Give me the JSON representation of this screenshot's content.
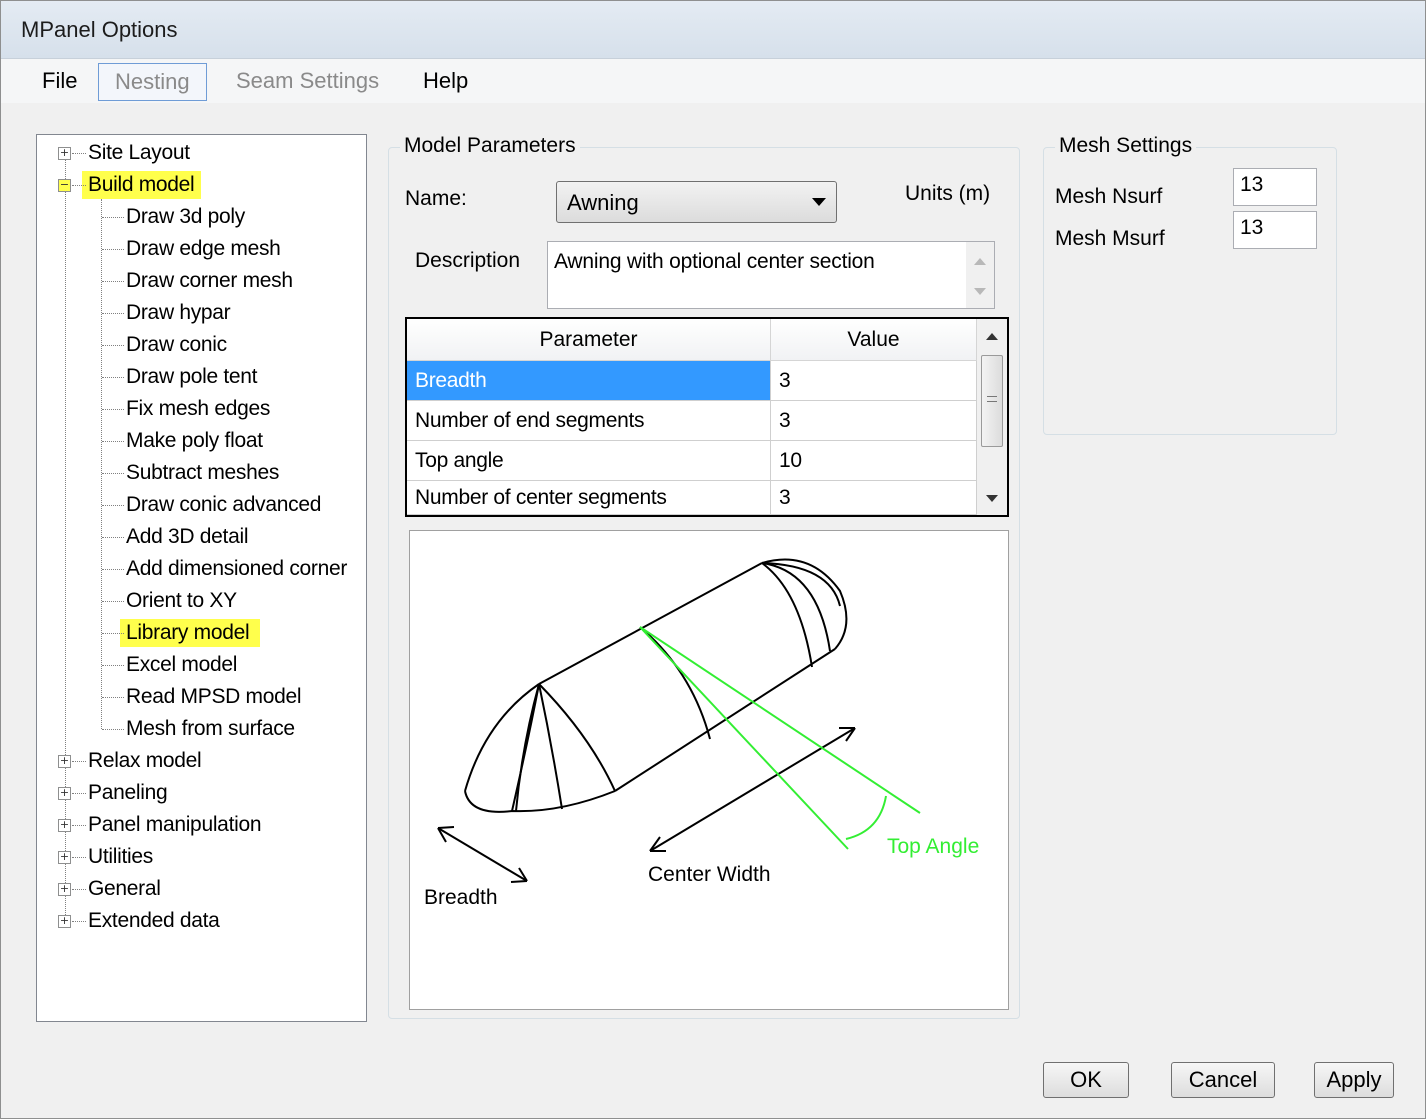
{
  "window": {
    "title": "MPanel Options"
  },
  "menu": [
    {
      "label": "File",
      "enabled": true
    },
    {
      "label": "Nesting",
      "enabled": false
    },
    {
      "label": "Seam Settings",
      "enabled": false
    },
    {
      "label": "Help",
      "enabled": true
    }
  ],
  "tree": {
    "top_before": [
      {
        "label": "Site Layout",
        "expanded": false
      }
    ],
    "expanded_node": {
      "label": "Build model",
      "highlighted": true
    },
    "children": [
      {
        "label": "Draw 3d poly"
      },
      {
        "label": "Draw edge mesh"
      },
      {
        "label": "Draw corner mesh"
      },
      {
        "label": "Draw hypar"
      },
      {
        "label": "Draw conic"
      },
      {
        "label": "Draw pole tent"
      },
      {
        "label": "Fix mesh edges"
      },
      {
        "label": "Make poly float"
      },
      {
        "label": "Subtract meshes"
      },
      {
        "label": "Draw conic advanced"
      },
      {
        "label": "Add 3D detail"
      },
      {
        "label": "Add dimensioned corner"
      },
      {
        "label": "Orient to XY"
      },
      {
        "label": "Library model",
        "highlighted": true
      },
      {
        "label": "Excel model"
      },
      {
        "label": "Read MPSD model"
      },
      {
        "label": "Mesh from surface"
      }
    ],
    "top_after": [
      {
        "label": "Relax model"
      },
      {
        "label": "Paneling"
      },
      {
        "label": "Panel manipulation"
      },
      {
        "label": "Utilities"
      },
      {
        "label": "General"
      },
      {
        "label": "Extended data"
      }
    ]
  },
  "model_params": {
    "group_title": "Model Parameters",
    "name_label": "Name:",
    "name_value": "Awning",
    "units_label": "Units (m)",
    "description_label": "Description",
    "description_value": "Awning with optional center section",
    "grid": {
      "headers": [
        "Parameter",
        "Value"
      ],
      "rows": [
        {
          "param": "Breadth",
          "value": "3",
          "selected": true
        },
        {
          "param": "Number of end segments",
          "value": "3"
        },
        {
          "param": "Top angle",
          "value": "10"
        },
        {
          "param": "Number of center segments",
          "value": "3"
        }
      ]
    },
    "preview_labels": {
      "breadth": "Breadth",
      "center_width": "Center Width",
      "top_angle": "Top Angle"
    }
  },
  "mesh_settings": {
    "group_title": "Mesh Settings",
    "nsurf_label": "Mesh Nsurf",
    "nsurf_value": "13",
    "msurf_label": "Mesh Msurf",
    "msurf_value": "13"
  },
  "buttons": {
    "ok": "OK",
    "cancel": "Cancel",
    "apply": "Apply"
  },
  "colors": {
    "highlight": "#ffff4c",
    "selection": "#3399ff",
    "angle_lines": "#33ee33"
  }
}
